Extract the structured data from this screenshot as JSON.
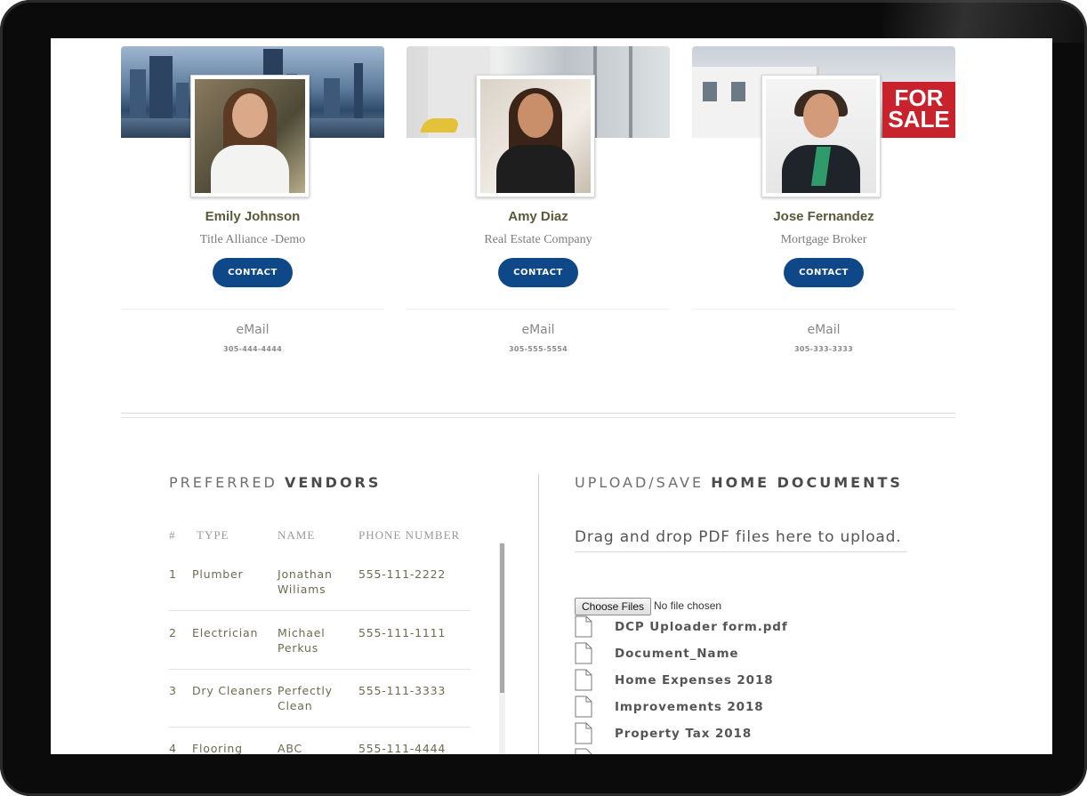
{
  "agents": [
    {
      "name": "Emily Johnson",
      "company": "Title Alliance -Demo",
      "contact_label": "CONTACT",
      "email_label": "eMail",
      "phone": "305-444-4444"
    },
    {
      "name": "Amy Diaz",
      "company": "Real Estate Company",
      "contact_label": "CONTACT",
      "email_label": "eMail",
      "phone": "305-555-5554"
    },
    {
      "name": "Jose Fernandez",
      "company": "Mortgage Broker",
      "contact_label": "CONTACT",
      "email_label": "eMail",
      "phone": "305-333-3333"
    }
  ],
  "banner_text": {
    "sale_line1": "FOR",
    "sale_line2": "SALE"
  },
  "vendors": {
    "title_prefix": "PREFERRED",
    "title_bold": "VENDORS",
    "columns": [
      "#",
      "TYPE",
      "NAME",
      "PHONE NUMBER"
    ],
    "rows": [
      {
        "num": "1",
        "type": "Plumber",
        "name_line1": "Jonathan",
        "name_line2": "Wiliams",
        "phone": "555-111-2222"
      },
      {
        "num": "2",
        "type": "Electrician",
        "name_line1": "Michael",
        "name_line2": "Perkus",
        "phone": "555-111-1111"
      },
      {
        "num": "3",
        "type": "Dry Cleaners",
        "name_line1": "Perfectly",
        "name_line2": "Clean",
        "phone": "555-111-3333"
      },
      {
        "num": "4",
        "type": "Flooring",
        "name_line1": "ABC",
        "name_line2": "",
        "phone": "555-111-4444"
      }
    ]
  },
  "upload": {
    "title_prefix": "UPLOAD/SAVE",
    "title_bold": "HOME DOCUMENTS",
    "dropzone_text": "Drag and drop PDF files here to upload.",
    "choose_files_label": "Choose Files",
    "no_file_text": "No file chosen",
    "documents": [
      "DCP Uploader form.pdf",
      "Document_Name",
      "Home Expenses 2018",
      "Improvements 2018",
      "Property Tax 2018"
    ]
  },
  "colors": {
    "accent": "#0f4888",
    "bezel": "#0b0b0b",
    "name_text": "#5a5a3a"
  }
}
